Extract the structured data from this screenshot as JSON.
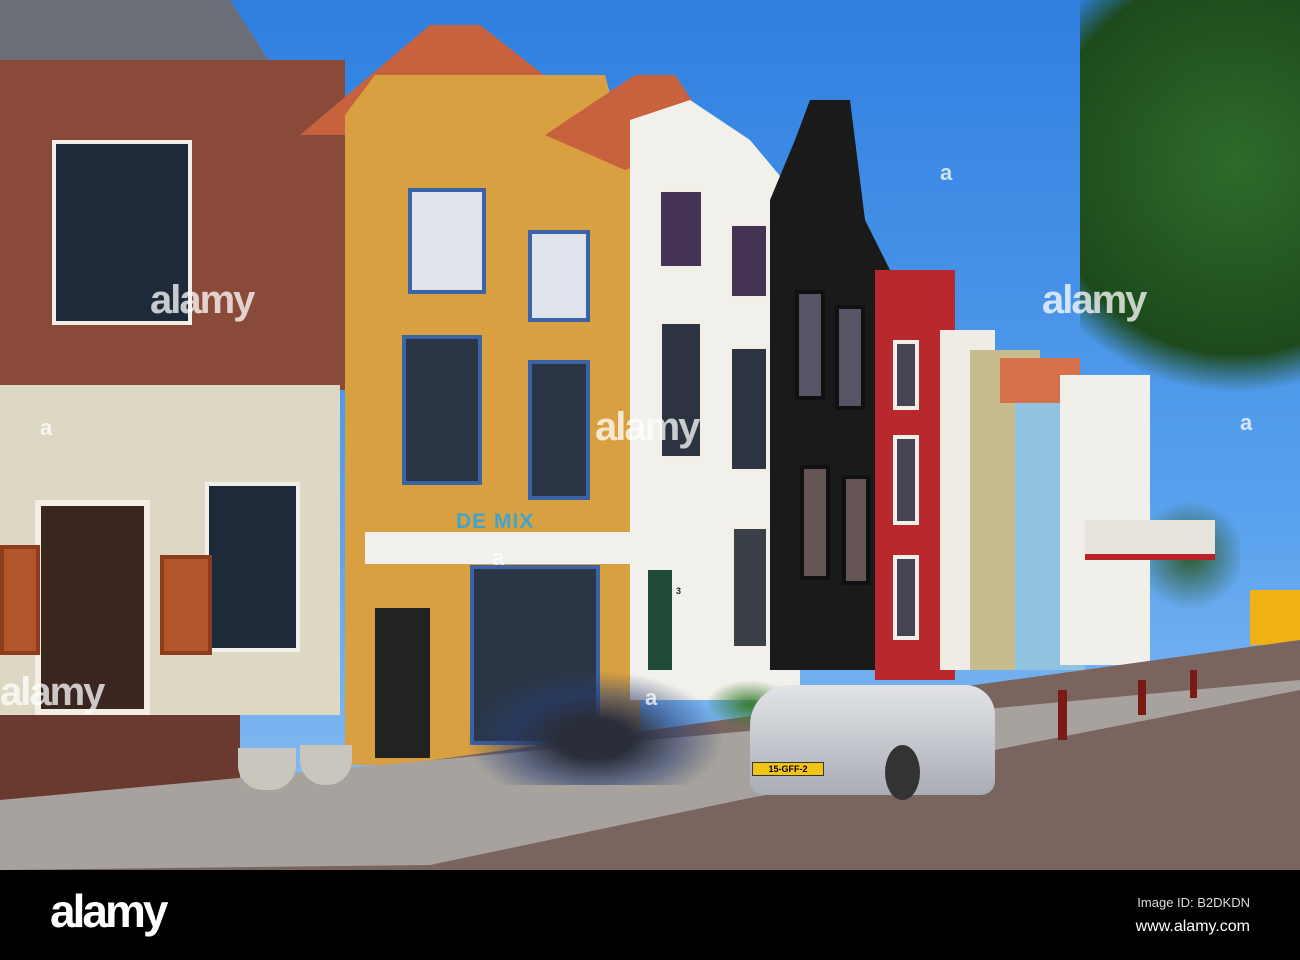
{
  "photo": {
    "shop_sign": "DE MIX",
    "house_number": "3",
    "license_plate": "15-GFF-2",
    "watermark": "alamy",
    "watermark_letter": "a"
  },
  "footer": {
    "logo": "alamy",
    "image_id": "Image ID: B2DKDN",
    "url": "www.alamy.com"
  },
  "colors": {
    "sky": "#3a8ae6",
    "brick": "#8a4a3a",
    "ochre": "#d9a042",
    "red_facade": "#b8282c",
    "black_facade": "#1a1a1a"
  }
}
